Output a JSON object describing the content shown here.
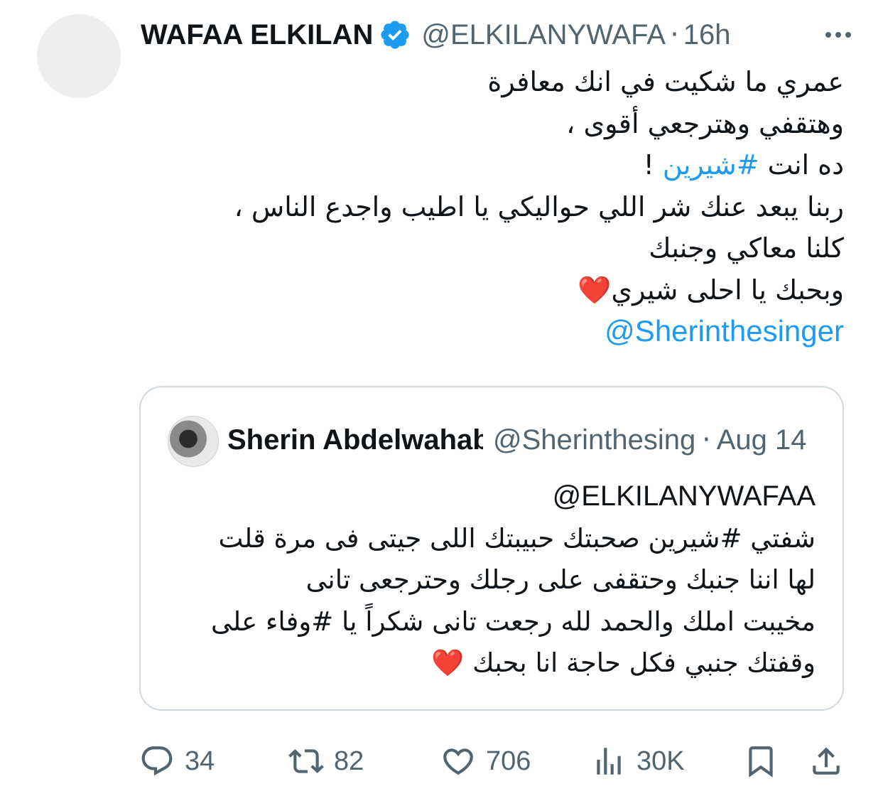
{
  "tweet": {
    "author_name": "WAFAA ELKILAN",
    "author_handle": "@ELKILANYWAFA",
    "separator": "·",
    "time": "16h",
    "lines": [
      "عمري ما شكيت في انك معافرة",
      "وهتقفي وهترجعي أقوى ،",
      "ده انت",
      "#شيرين",
      "!",
      "ربنا يبعد عنك شر اللي حواليكي يا اطيب واجدع الناس ،",
      "كلنا معاكي وجنبك",
      "وبحبك يا احلى شيري",
      "❤️",
      "@Sherinthesinger"
    ]
  },
  "quote": {
    "author_name": "Sherin Abdelwahab",
    "author_handle": "@Sherinthesinger",
    "separator": "·",
    "time": "Aug 14",
    "lines": [
      "@ELKILANYWAFAA",
      "شفتي #شيرين  صحبتك حبيبتك اللى جيتى فى مرة قلت",
      "لها  اننا جنبك وحتقفى على رجلك وحترجعى تانى",
      "مخيبت املك والحمد لله رجعت تانى شكراً يا #وفاء على",
      "وقفتك جنبي فكل حاجة انا بحبك",
      "❤️"
    ]
  },
  "actions": {
    "replies": "34",
    "reposts": "82",
    "likes": "706",
    "views": "30K"
  },
  "colors": {
    "text": "#0f1419",
    "secondary": "#536471",
    "link": "#1d9bf0",
    "verified": "#1d9bf0",
    "heart": "#d0243b",
    "border": "#cfd9de"
  },
  "icons": [
    "verified-badge-icon",
    "more-icon",
    "reply-icon",
    "repost-icon",
    "like-icon",
    "views-icon",
    "bookmark-icon",
    "share-icon",
    "heart-emoji-icon"
  ]
}
